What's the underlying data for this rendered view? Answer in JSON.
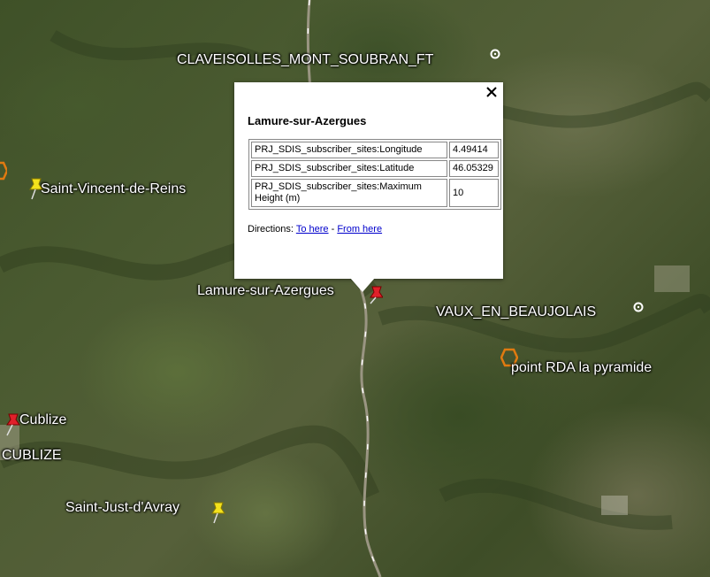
{
  "map": {
    "labels": {
      "claveisolles": "CLAVEISOLLES_MONT_SOUBRAN_FT",
      "saint_vincent": "Saint-Vincent-de-Reins",
      "lamure": "Lamure-sur-Azergues",
      "vaux": "VAUX_EN_BEAUJOLAIS",
      "point_rda": "point RDA la pyramide",
      "cublize": "Cublize",
      "cublize_caps": "CUBLIZE",
      "saint_just": "Saint-Just-d'Avray"
    },
    "marker_colors": {
      "yellow_pin": "#f4e21c",
      "red_pin": "#e0202a",
      "orange_hexagon": "#e07a10",
      "white_circle": "#ffffff"
    },
    "icons": {
      "yellow_pin": "yellow-pushpin-icon",
      "red_pin": "red-pushpin-icon",
      "hexagon": "hexagon-icon",
      "circle": "target-circle-icon"
    }
  },
  "popup": {
    "title": "Lamure-sur-Azergues",
    "rows": [
      {
        "key": "PRJ_SDIS_subscriber_sites:Longitude",
        "value": "4.49414"
      },
      {
        "key": "PRJ_SDIS_subscriber_sites:Latitude",
        "value": "46.05329"
      },
      {
        "key": "PRJ_SDIS_subscriber_sites:Maximum Height (m)",
        "value": "10"
      }
    ],
    "directions_label": "Directions:",
    "to_here": "To here",
    "separator": "-",
    "from_here": "From here",
    "close_icon": "close-icon"
  }
}
